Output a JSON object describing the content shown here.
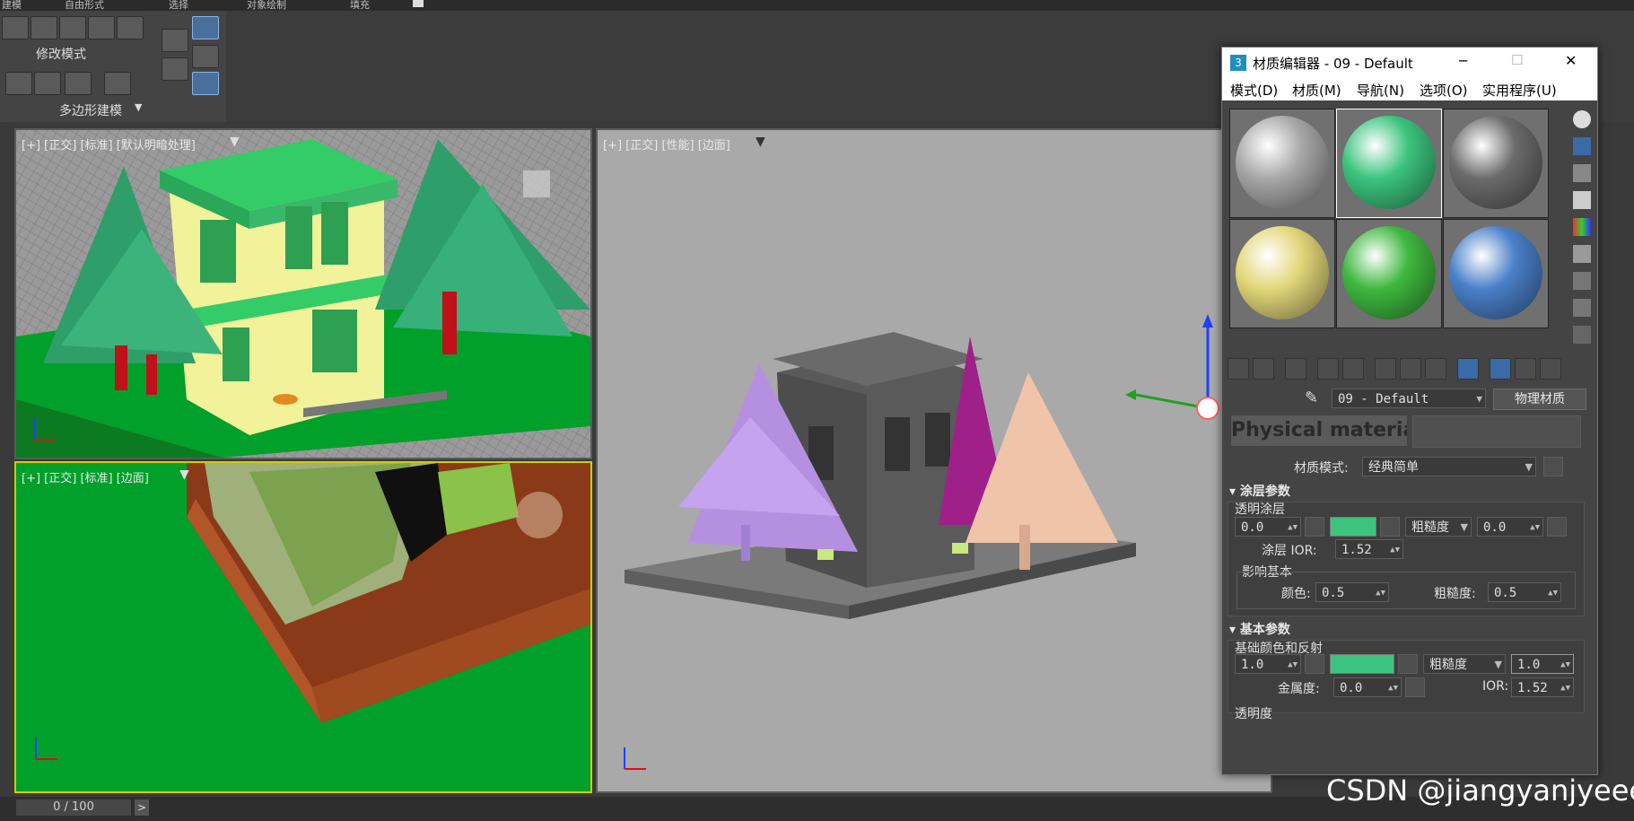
{
  "ribbon": {
    "tabs": [
      "建模",
      "自由形式",
      "选择",
      "对象绘制",
      "填充"
    ],
    "modify_mode_label": "修改模式",
    "poly_modeling_label": "多边形建模"
  },
  "viewports": {
    "top_left_label": "[+] [正交] [标准] [默认明暗处理]",
    "bottom_left_label": "[+] [正交] [标准] [边面]",
    "right_label": "[+] [正交] [性能] [边面]"
  },
  "status": {
    "frame_counter": "0 / 100",
    "next_glyph": ">"
  },
  "watermark": "CSDN @jiangyanjyeee",
  "material_editor": {
    "title": "材质编辑器 - 09 - Default",
    "app_icon_label": "3",
    "window_controls": {
      "minimize": "─",
      "maximize": "☐",
      "close": "✕"
    },
    "menu": [
      "模式(D)",
      "材质(M)",
      "导航(N)",
      "选项(O)",
      "实用程序(U)"
    ],
    "slots": [
      {
        "color": "#a8a8a8"
      },
      {
        "color": "#3cc47e"
      },
      {
        "color": "#6b6b6b"
      },
      {
        "color": "#e3d77a"
      },
      {
        "color": "#3fb83f"
      },
      {
        "color": "#4a80c9"
      }
    ],
    "active_slot": 1,
    "material_name": "09 - Default",
    "material_type_button": "物理材质",
    "banner_text": "Physical material",
    "material_mode_label": "材质模式:",
    "material_mode_value": "经典简单",
    "coating": {
      "header": "涂层参数",
      "clearcoat_label": "透明涂层",
      "weight": "0.0",
      "roughness_mode": "粗糙度",
      "roughness_value": "0.0",
      "ior_label": "涂层 IOR:",
      "ior_value": "1.52",
      "affect_label": "影响基本",
      "color_label": "颜色:",
      "color_value": "0.5",
      "rough_label": "粗糙度:",
      "rough_value": "0.5",
      "swatch_color": "#3cc47e"
    },
    "basic": {
      "header": "基本参数",
      "base_label": "基础颜色和反射",
      "weight": "1.0",
      "roughness_mode": "粗糙度",
      "roughness_value": "1.0",
      "metalness_label": "金属度:",
      "metalness_value": "0.0",
      "ior_label": "IOR:",
      "ior_value": "1.52",
      "transparency_label": "透明度",
      "swatch_color": "#3cc47e"
    }
  }
}
